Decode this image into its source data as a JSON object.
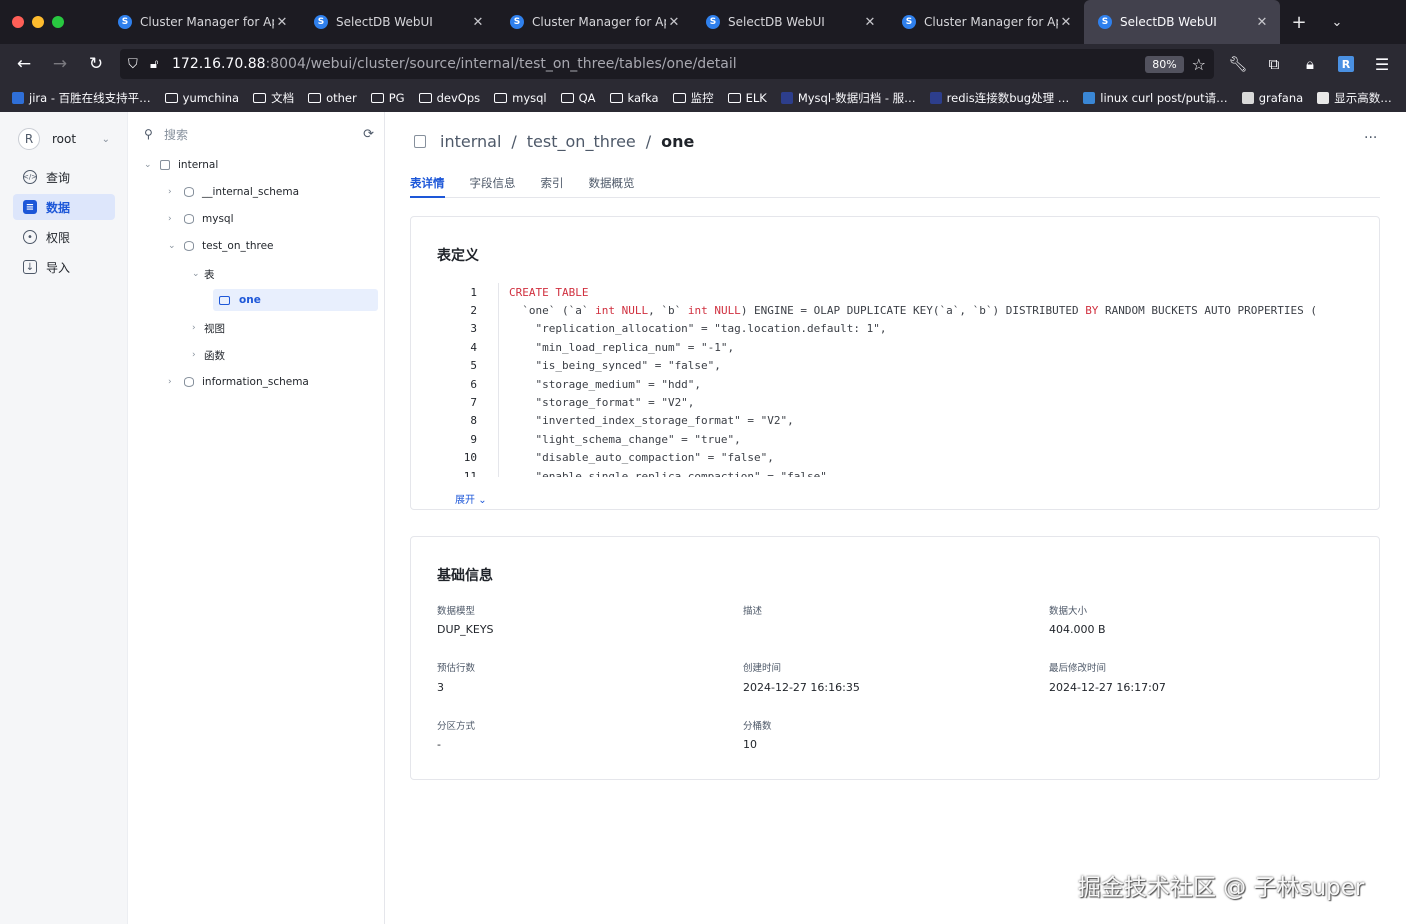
{
  "browser": {
    "tabs": [
      {
        "title": "Cluster Manager for Apach",
        "active": false
      },
      {
        "title": "SelectDB WebUI",
        "active": false
      },
      {
        "title": "Cluster Manager for Apach",
        "active": false
      },
      {
        "title": "SelectDB WebUI",
        "active": false
      },
      {
        "title": "Cluster Manager for Apach",
        "active": false
      },
      {
        "title": "SelectDB WebUI",
        "active": true
      }
    ],
    "url_host": "172.16.70.88",
    "url_rest": ":8004/webui/cluster/source/internal/test_on_three/tables/one/detail",
    "zoom": "80%",
    "profile_letter": "R",
    "bookmarks": [
      {
        "label": "jira - 百胜在线支持平…",
        "type": "site",
        "color": "#2f6fd8"
      },
      {
        "label": "yumchina",
        "type": "folder"
      },
      {
        "label": "文档",
        "type": "folder"
      },
      {
        "label": "other",
        "type": "folder"
      },
      {
        "label": "PG",
        "type": "folder"
      },
      {
        "label": "devOps",
        "type": "folder"
      },
      {
        "label": "mysql",
        "type": "folder"
      },
      {
        "label": "QA",
        "type": "folder"
      },
      {
        "label": "kafka",
        "type": "folder"
      },
      {
        "label": "监控",
        "type": "folder"
      },
      {
        "label": "ELK",
        "type": "folder"
      },
      {
        "label": "Mysql-数据归档 - 服…",
        "type": "site",
        "color": "#2d3e8c"
      },
      {
        "label": "redis连接数bug处理 …",
        "type": "site",
        "color": "#2d3e8c"
      },
      {
        "label": "linux curl post/put请…",
        "type": "site",
        "color": "#3a87d6"
      },
      {
        "label": "grafana",
        "type": "site",
        "color": "#d9d9d9"
      },
      {
        "label": "显示高数…",
        "type": "site",
        "color": "#e8e8e8"
      }
    ]
  },
  "leftnav": {
    "avatar_letter": "R",
    "user": "root",
    "items": [
      {
        "label": "查询",
        "active": false
      },
      {
        "label": "数据",
        "active": true
      },
      {
        "label": "权限",
        "active": false
      },
      {
        "label": "导入",
        "active": false
      }
    ]
  },
  "tree": {
    "search_placeholder": "搜索",
    "nodes": [
      {
        "label": "internal",
        "level": 0
      },
      {
        "label": "__internal_schema",
        "level": 1
      },
      {
        "label": "mysql",
        "level": 1
      },
      {
        "label": "test_on_three",
        "level": 1
      },
      {
        "label": "表",
        "level": 2
      },
      {
        "label": "one",
        "level": 3
      },
      {
        "label": "视图",
        "level": 2
      },
      {
        "label": "函数",
        "level": 2
      },
      {
        "label": "information_schema",
        "level": 1
      }
    ]
  },
  "main": {
    "breadcrumb": [
      "internal",
      "test_on_three",
      "one"
    ],
    "tabs": [
      {
        "label": "表详情",
        "active": true
      },
      {
        "label": "字段信息",
        "active": false
      },
      {
        "label": "索引",
        "active": false
      },
      {
        "label": "数据概览",
        "active": false
      }
    ],
    "definition_title": "表定义",
    "code_lines": [
      "CREATE TABLE",
      "  `one` (`a` int NULL, `b` int NULL) ENGINE = OLAP DUPLICATE KEY(`a`, `b`) DISTRIBUTED BY RANDOM BUCKETS AUTO PROPERTIES (",
      "    \"replication_allocation\" = \"tag.location.default: 1\",",
      "    \"min_load_replica_num\" = \"-1\",",
      "    \"is_being_synced\" = \"false\",",
      "    \"storage_medium\" = \"hdd\",",
      "    \"storage_format\" = \"V2\",",
      "    \"inverted_index_storage_format\" = \"V2\",",
      "    \"light_schema_change\" = \"true\",",
      "    \"disable_auto_compaction\" = \"false\",",
      "    \"enable_single_replica_compaction\" = \"false\","
    ],
    "expand_label": "展开",
    "basic_title": "基础信息",
    "info": [
      {
        "label": "数据模型",
        "value": "DUP_KEYS"
      },
      {
        "label": "描述",
        "value": ""
      },
      {
        "label": "数据大小",
        "value": "404.000 B"
      },
      {
        "label": "预估行数",
        "value": "3"
      },
      {
        "label": "创建时间",
        "value": "2024-12-27 16:16:35"
      },
      {
        "label": "最后修改时间",
        "value": "2024-12-27 16:17:07"
      },
      {
        "label": "分区方式",
        "value": "-"
      },
      {
        "label": "分桶数",
        "value": "10"
      }
    ]
  },
  "watermark": "掘金技术社区 @ 子林super"
}
